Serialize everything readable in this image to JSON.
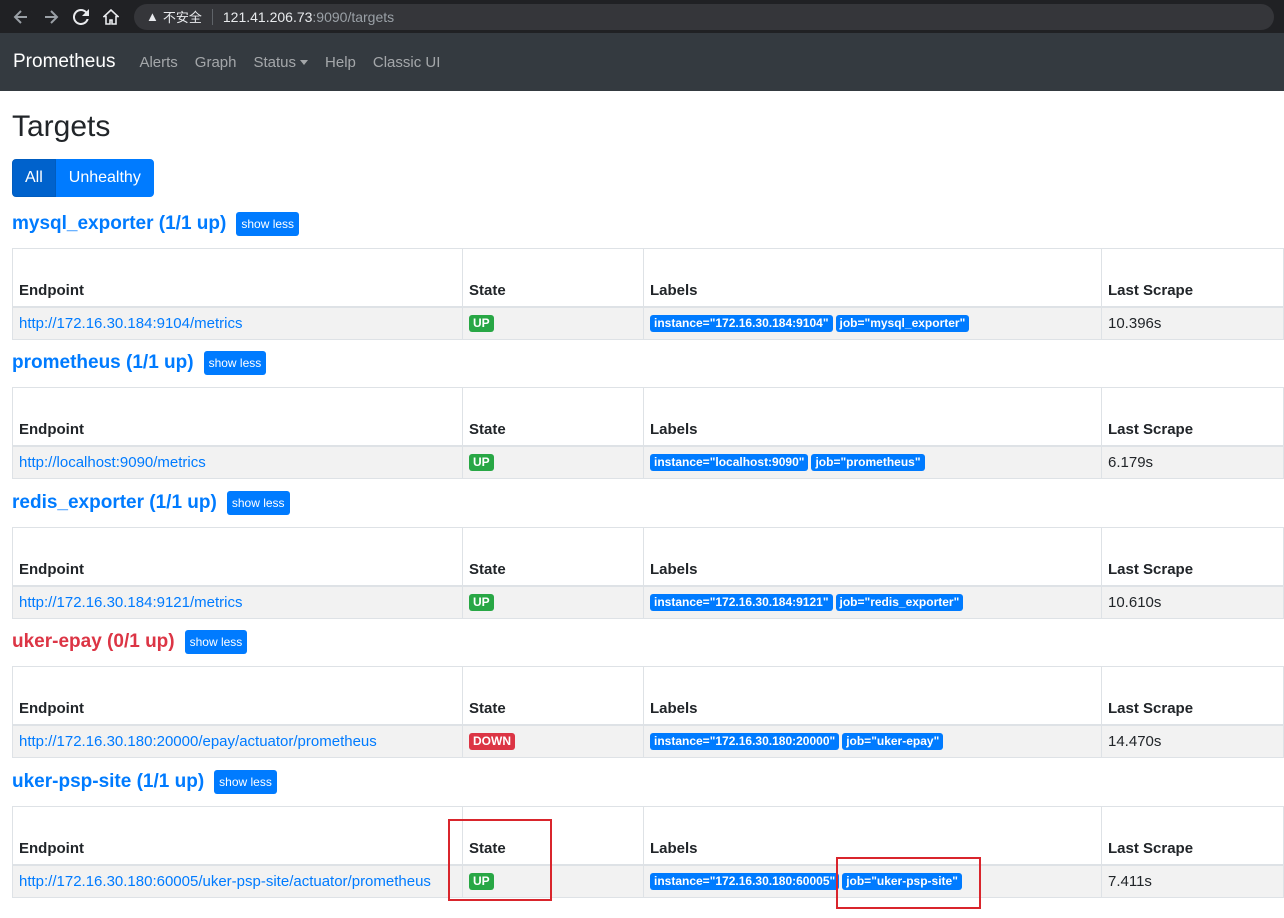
{
  "browser": {
    "insecure_label": "不安全",
    "url_host": "121.41.206.73",
    "url_path": ":9090/targets"
  },
  "navbar": {
    "brand": "Prometheus",
    "links": [
      "Alerts",
      "Graph",
      "Status",
      "Help",
      "Classic UI"
    ]
  },
  "page": {
    "title": "Targets",
    "filter_all": "All",
    "filter_unhealthy": "Unhealthy"
  },
  "columns": {
    "endpoint": "Endpoint",
    "state": "State",
    "labels": "Labels",
    "last_scrape": "Last Scrape"
  },
  "show_less": "show less",
  "jobs": [
    {
      "title": "mysql_exporter (1/1 up)",
      "healthy": true,
      "endpoint": "http://172.16.30.184:9104/metrics",
      "state": "UP",
      "labels": [
        "instance=\"172.16.30.184:9104\"",
        "job=\"mysql_exporter\""
      ],
      "last_scrape": "10.396s"
    },
    {
      "title": "prometheus (1/1 up)",
      "healthy": true,
      "endpoint": "http://localhost:9090/metrics",
      "state": "UP",
      "labels": [
        "instance=\"localhost:9090\"",
        "job=\"prometheus\""
      ],
      "last_scrape": "6.179s"
    },
    {
      "title": "redis_exporter (1/1 up)",
      "healthy": true,
      "endpoint": "http://172.16.30.184:9121/metrics",
      "state": "UP",
      "labels": [
        "instance=\"172.16.30.184:9121\"",
        "job=\"redis_exporter\""
      ],
      "last_scrape": "10.610s"
    },
    {
      "title": "uker-epay (0/1 up)",
      "healthy": false,
      "endpoint": "http://172.16.30.180:20000/epay/actuator/prometheus",
      "state": "DOWN",
      "labels": [
        "instance=\"172.16.30.180:20000\"",
        "job=\"uker-epay\""
      ],
      "last_scrape": "14.470s"
    },
    {
      "title": "uker-psp-site (1/1 up)",
      "healthy": true,
      "endpoint": "http://172.16.30.180:60005/uker-psp-site/actuator/prometheus",
      "state": "UP",
      "labels": [
        "instance=\"172.16.30.180:60005\"",
        "job=\"uker-psp-site\""
      ],
      "last_scrape": "7.411s"
    }
  ],
  "colors": {
    "primary": "#007bff",
    "up": "#28a745",
    "down": "#dc3545",
    "navbar": "#343a40",
    "annotation": "#d9252c"
  }
}
